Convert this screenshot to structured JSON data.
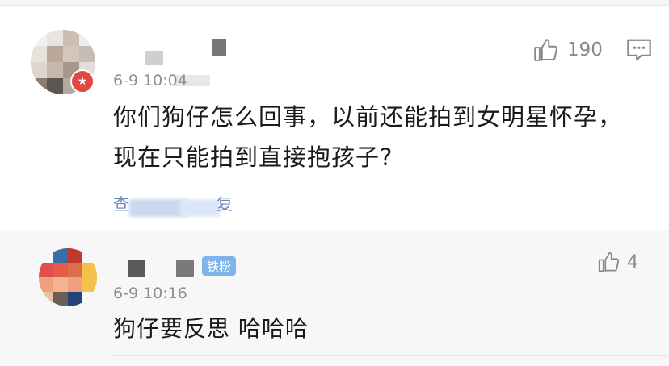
{
  "main_comment": {
    "timestamp": "6-9 10:04",
    "like_count": "190",
    "text_line1": "你们狗仔怎么回事，以前还能拍到女明星怀孕，",
    "text_line2": "现在只能拍到直接抱孩子?",
    "more_prefix": "查",
    "more_suffix": "复",
    "verified_badge_icon": "verified-badge-icon"
  },
  "reply": {
    "fan_badge": "铁粉",
    "timestamp": "6-9 10:16",
    "like_count": "4",
    "text": "狗仔要反思 哈哈哈"
  },
  "colors": {
    "link": "#6a86b5",
    "badge_red": "#e2483d",
    "fan_badge_blue": "#7fb4ea",
    "muted_text": "#8f8f8f"
  }
}
